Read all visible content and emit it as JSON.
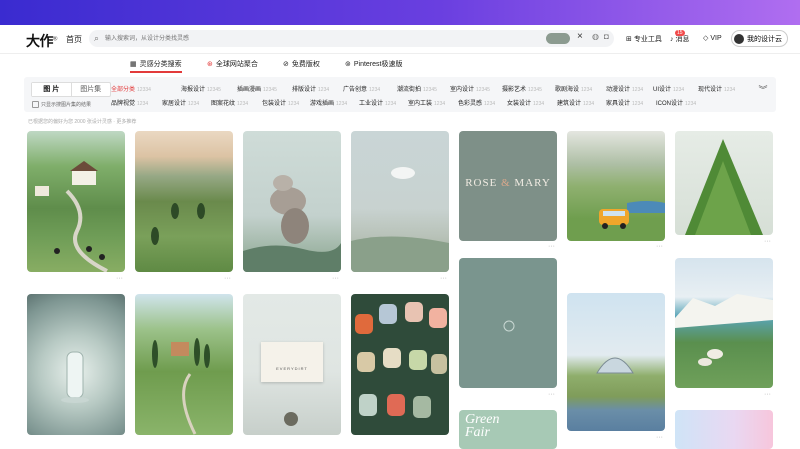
{
  "header": {
    "logo": "大作",
    "logo_mark": "®",
    "home": "首页",
    "search_placeholder": "输入搜索词，从设计分类找灵感",
    "pro_tools": "专业工具",
    "messages": "消息",
    "messages_badge": "15",
    "vip": "VIP",
    "my_design_cloud": "我的设计云"
  },
  "tabs": [
    {
      "label": "灵感分类搜索",
      "icon": "grid-icon"
    },
    {
      "label": "全球网站聚合",
      "icon": "globe-icon"
    },
    {
      "label": "免费版权",
      "icon": "copyright-icon"
    },
    {
      "label": "Pinterest极速版",
      "icon": "pinterest-icon"
    }
  ],
  "filters": {
    "segment_images": "图 片",
    "segment_collections": "图片集",
    "checkbox_label": "只显示搜图片集的结果",
    "row1": [
      {
        "label": "全部分类",
        "count": "12334"
      },
      {
        "label": "海报设计",
        "count": "12345"
      },
      {
        "label": "插画漫画",
        "count": "12345"
      },
      {
        "label": "排版设计",
        "count": "1234"
      },
      {
        "label": "广告创意",
        "count": "1234"
      },
      {
        "label": "潮流街拍",
        "count": "12345"
      },
      {
        "label": "室内设计",
        "count": "12345"
      },
      {
        "label": "摄影艺术",
        "count": "12345"
      },
      {
        "label": "歌剧海设",
        "count": "1234"
      },
      {
        "label": "动漫设计",
        "count": "1234"
      },
      {
        "label": "UI设计",
        "count": "1234"
      },
      {
        "label": "现代设计",
        "count": "1234"
      }
    ],
    "row2": [
      {
        "label": "品牌视觉",
        "count": "1234"
      },
      {
        "label": "家居设计",
        "count": "1234"
      },
      {
        "label": "图案花纹",
        "count": "1234"
      },
      {
        "label": "包装设计",
        "count": "1234"
      },
      {
        "label": "游戏插画",
        "count": "1234"
      },
      {
        "label": "工业设计",
        "count": "1234"
      },
      {
        "label": "室内工装",
        "count": "1234"
      },
      {
        "label": "色彩灵感",
        "count": "1234"
      },
      {
        "label": "女装设计",
        "count": "1234"
      },
      {
        "label": "建筑设计",
        "count": "1234"
      },
      {
        "label": "家具设计",
        "count": "1234"
      },
      {
        "label": "ICON设计",
        "count": "1234"
      }
    ]
  },
  "note": "已根据您的偏好为您 2000 张设计灵感 · 更多推荐",
  "cards": {
    "rose_mary_text_1": "ROSE",
    "rose_mary_amp": "&",
    "rose_mary_text_2": "MARY",
    "green_fair_1": "Green",
    "green_fair_2": "Fair",
    "everydirt": "EVERYDIRT"
  },
  "colors": {
    "accent_red": "#e23a3a",
    "brand_purple": "#5b3fe0",
    "rose_mary_bg": "#7e9088",
    "sage_bg": "#7a958e",
    "green_fair_bg": "#a7c9b5"
  }
}
